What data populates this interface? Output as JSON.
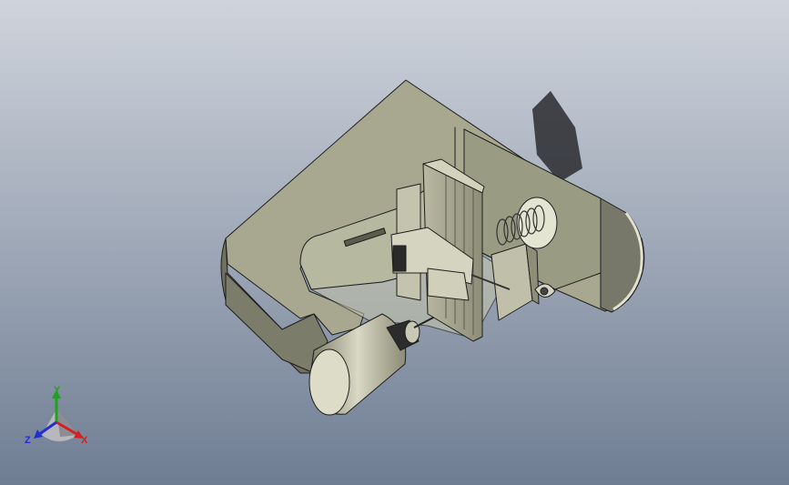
{
  "viewport": {
    "background_top": "#cfd4dc",
    "background_bottom": "#6f7d93"
  },
  "model": {
    "body_color": "#a3a48a",
    "body_dark": "#6c6c58",
    "body_light": "#cfcfba",
    "outline": "#1e1e1e"
  },
  "triad": {
    "x_label": "X",
    "y_label": "Y",
    "z_label": "Z",
    "x_color": "#d42020",
    "y_color": "#1fa31f",
    "z_color": "#2030d0"
  }
}
